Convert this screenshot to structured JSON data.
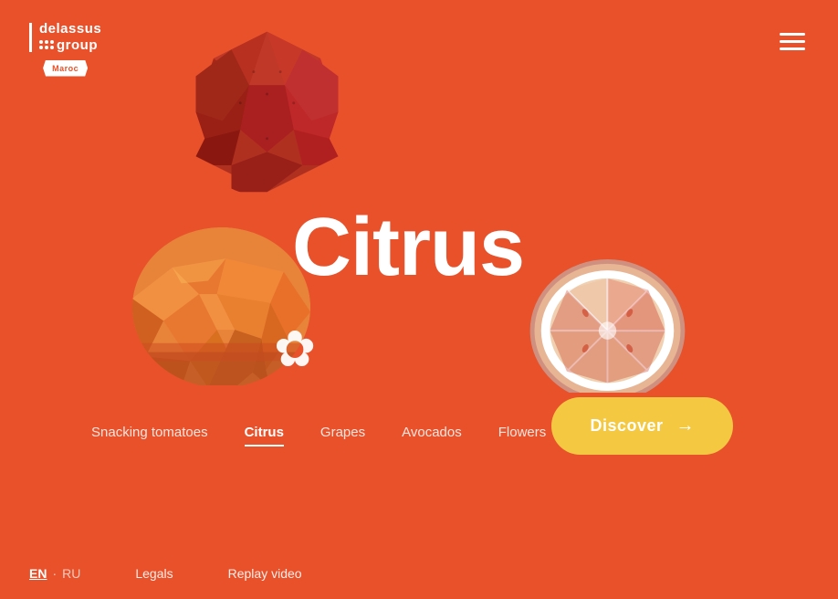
{
  "header": {
    "logo": {
      "line1": "delassus",
      "line2": "group",
      "badge": "Maroc"
    },
    "menu_label": "menu"
  },
  "hero": {
    "title": "Citrus"
  },
  "nav": {
    "items": [
      {
        "label": "Snacking tomatoes",
        "active": false
      },
      {
        "label": "Citrus",
        "active": true
      },
      {
        "label": "Grapes",
        "active": false
      },
      {
        "label": "Avocados",
        "active": false
      },
      {
        "label": "Flowers",
        "active": false
      }
    ]
  },
  "discover_button": {
    "label": "Discover",
    "arrow": "→"
  },
  "footer": {
    "lang_en": "EN",
    "lang_separator": "·",
    "lang_ru": "RU",
    "legals": "Legals",
    "replay": "Replay video"
  },
  "colors": {
    "bg": "#E8512A",
    "button_yellow": "#F5C842",
    "white": "#FFFFFF"
  }
}
